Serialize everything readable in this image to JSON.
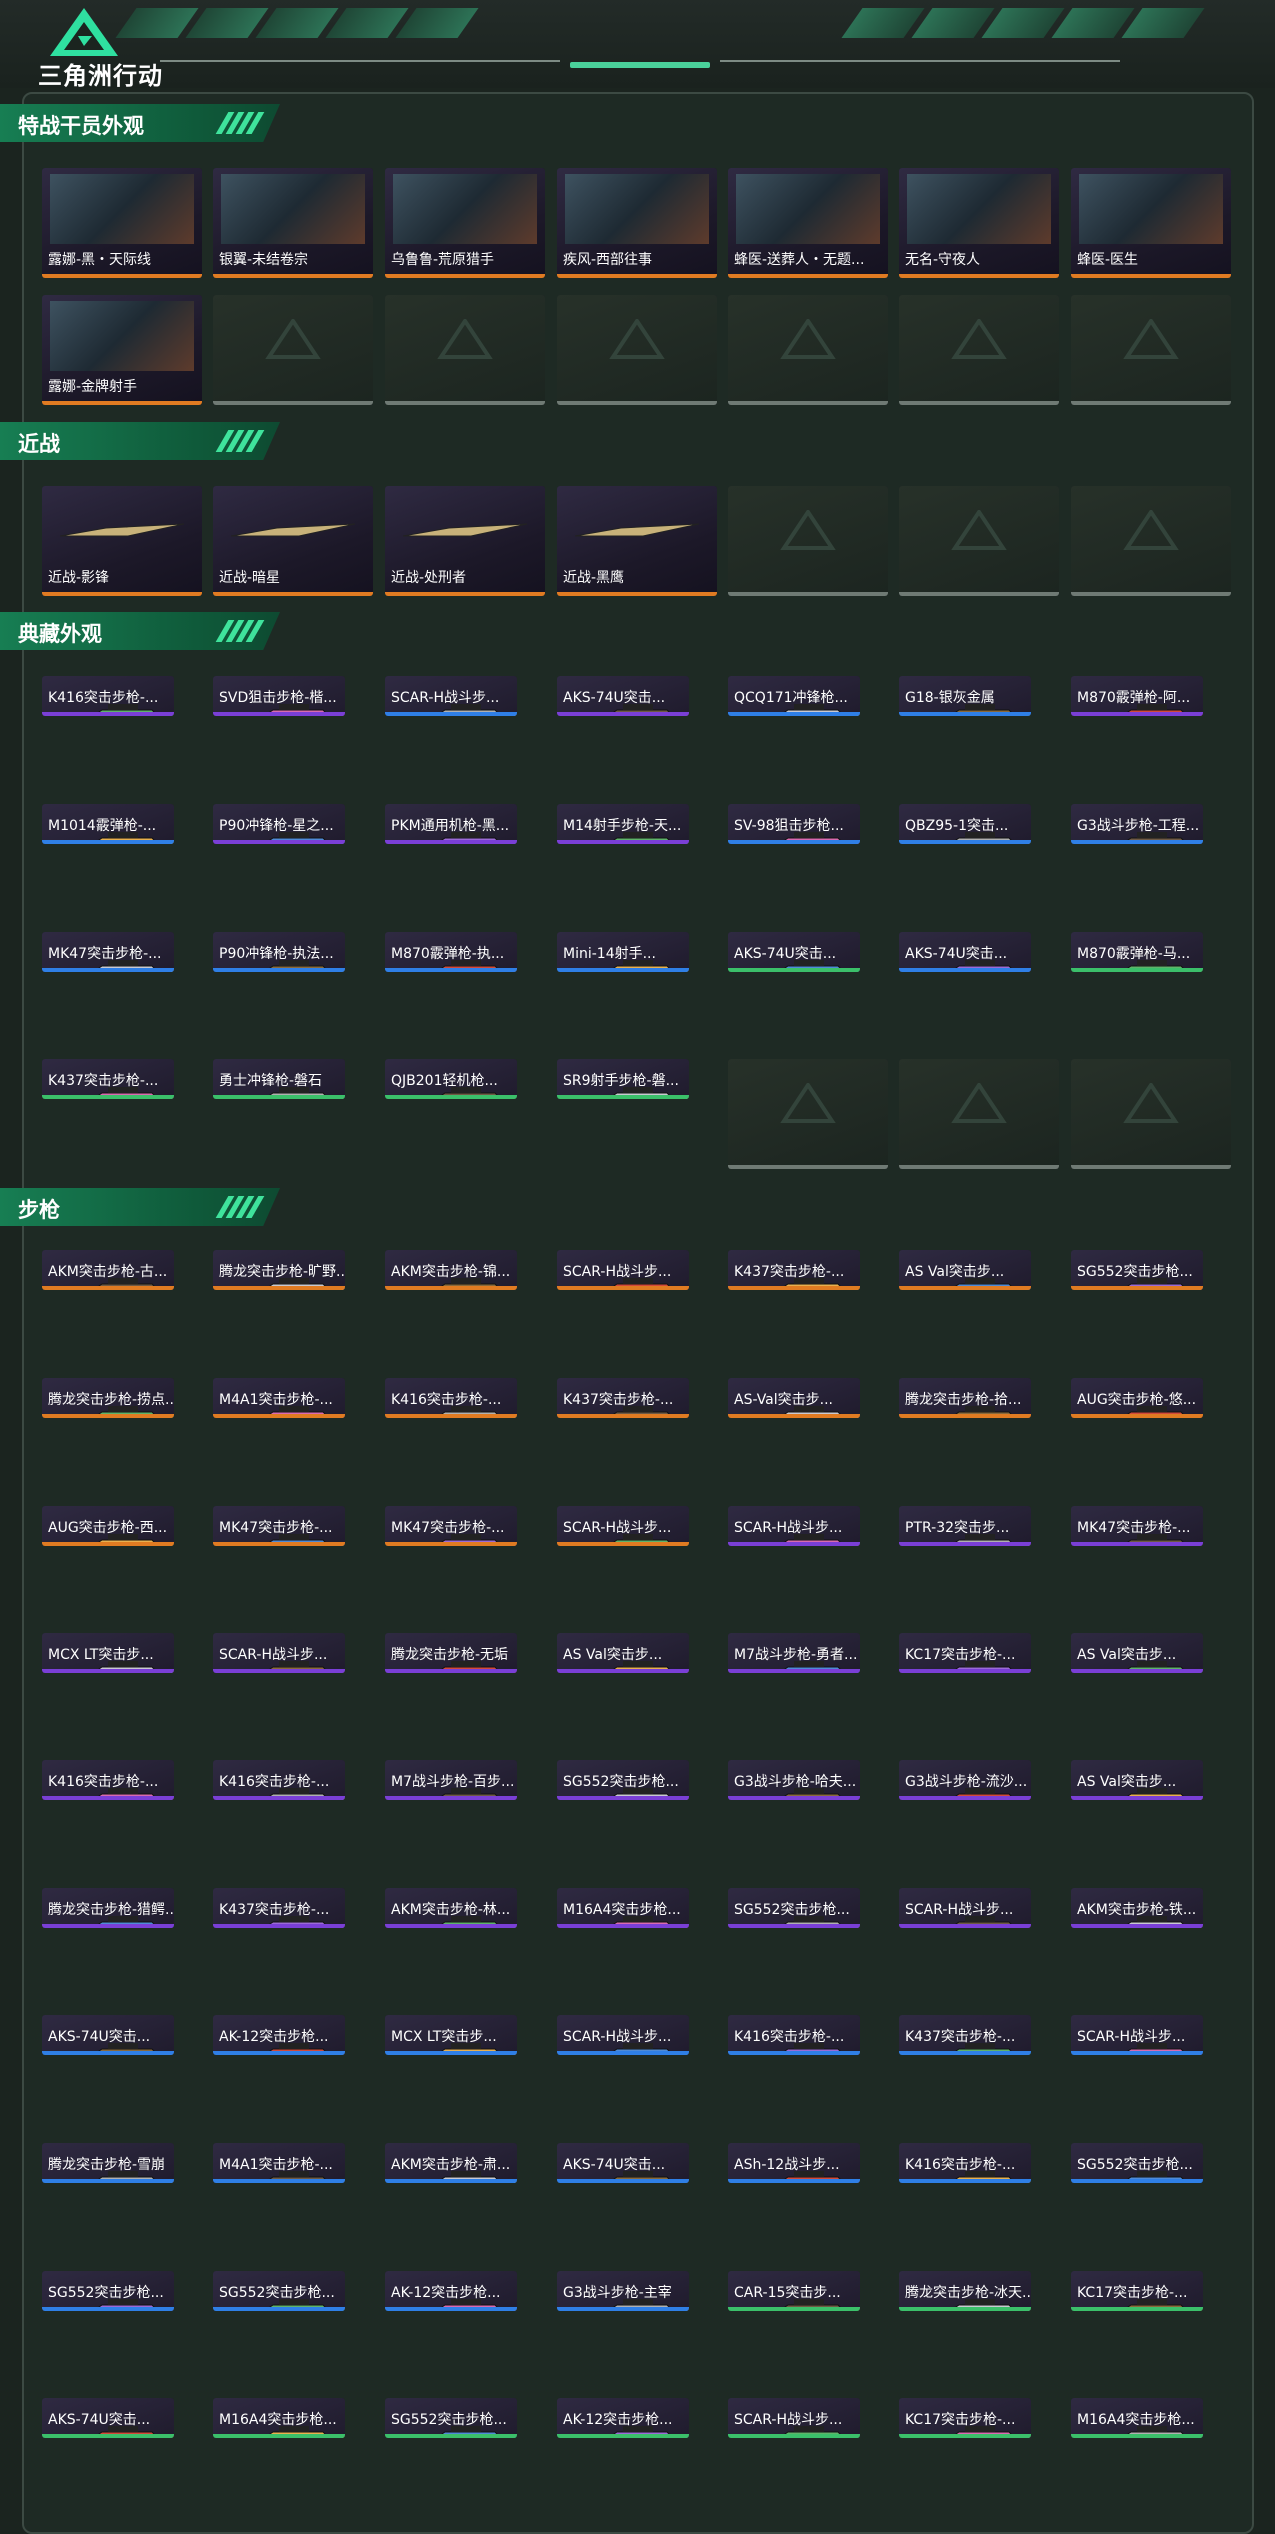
{
  "header": {
    "logo_text": "三角洲行动",
    "logo_icon": "delta-triangle-logo"
  },
  "colors": {
    "gold": "#e07b22",
    "purple": "#7a3fd6",
    "blue": "#2f7fe6",
    "green": "#3bbf6a",
    "empty": "#6f7a74",
    "accent": "#3fe39c"
  },
  "sections": [
    {
      "title": "特战干员外观",
      "items": [
        {
          "label": "露娜-黑・天际线",
          "rarity": "gold"
        },
        {
          "label": "银翼-未结卷宗",
          "rarity": "gold"
        },
        {
          "label": "乌鲁鲁-荒原猎手",
          "rarity": "gold"
        },
        {
          "label": "疾风-西部往事",
          "rarity": "gold"
        },
        {
          "label": "蜂医-送葬人・无题...",
          "rarity": "gold"
        },
        {
          "label": "无名-守夜人",
          "rarity": "gold"
        },
        {
          "label": "蜂医-医生",
          "rarity": "gold"
        },
        {
          "label": "露娜-金牌射手",
          "rarity": "gold"
        }
      ]
    },
    {
      "title": "近战",
      "items": [
        {
          "label": "近战-影锋",
          "rarity": "gold"
        },
        {
          "label": "近战-暗星",
          "rarity": "gold"
        },
        {
          "label": "近战-处刑者",
          "rarity": "gold"
        },
        {
          "label": "近战-黑鹰",
          "rarity": "gold"
        }
      ]
    },
    {
      "title": "典藏外观",
      "items": [
        {
          "label": "K416突击步枪-...",
          "rarity": "purple"
        },
        {
          "label": "SVD狙击步枪-楷...",
          "rarity": "purple"
        },
        {
          "label": "SCAR-H战斗步...",
          "rarity": "blue"
        },
        {
          "label": "AKS-74U突击...",
          "rarity": "purple"
        },
        {
          "label": "QCQ171冲锋枪...",
          "rarity": "blue"
        },
        {
          "label": "G18-银灰金属",
          "rarity": "blue"
        },
        {
          "label": "M870霰弹枪-阿...",
          "rarity": "purple"
        },
        {
          "label": "M1014霰弹枪-...",
          "rarity": "blue"
        },
        {
          "label": "P90冲锋枪-星之...",
          "rarity": "purple"
        },
        {
          "label": "PKM通用机枪-黑...",
          "rarity": "purple"
        },
        {
          "label": "M14射手步枪-天...",
          "rarity": "purple"
        },
        {
          "label": "SV-98狙击步枪...",
          "rarity": "blue"
        },
        {
          "label": "QBZ95-1突击...",
          "rarity": "blue"
        },
        {
          "label": "G3战斗步枪-工程...",
          "rarity": "blue"
        },
        {
          "label": "MK47突击步枪-...",
          "rarity": "blue"
        },
        {
          "label": "P90冲锋枪-执法...",
          "rarity": "blue"
        },
        {
          "label": "M870霰弹枪-执...",
          "rarity": "blue"
        },
        {
          "label": "Mini-14射手...",
          "rarity": "blue"
        },
        {
          "label": "AKS-74U突击...",
          "rarity": "green"
        },
        {
          "label": "AKS-74U突击...",
          "rarity": "blue"
        },
        {
          "label": "M870霰弹枪-马...",
          "rarity": "green"
        },
        {
          "label": "K437突击步枪-...",
          "rarity": "green"
        },
        {
          "label": "勇士冲锋枪-磐石",
          "rarity": "green"
        },
        {
          "label": "QJB201轻机枪...",
          "rarity": "green"
        },
        {
          "label": "SR9射手步枪-磐...",
          "rarity": "green"
        }
      ]
    },
    {
      "title": "步枪",
      "items": [
        {
          "label": "AKM突击步枪-古...",
          "rarity": "gold"
        },
        {
          "label": "腾龙突击步枪-旷野...",
          "rarity": "gold"
        },
        {
          "label": "AKM突击步枪-锦...",
          "rarity": "gold"
        },
        {
          "label": "SCAR-H战斗步...",
          "rarity": "gold"
        },
        {
          "label": "K437突击步枪-...",
          "rarity": "gold"
        },
        {
          "label": "AS Val突击步...",
          "rarity": "gold"
        },
        {
          "label": "SG552突击步枪...",
          "rarity": "gold"
        },
        {
          "label": "腾龙突击步枪-捞点...",
          "rarity": "gold"
        },
        {
          "label": "M4A1突击步枪-...",
          "rarity": "gold"
        },
        {
          "label": "K416突击步枪-...",
          "rarity": "gold"
        },
        {
          "label": "K437突击步枪-...",
          "rarity": "gold"
        },
        {
          "label": "AS-Val突击步...",
          "rarity": "gold"
        },
        {
          "label": "腾龙突击步枪-拾...",
          "rarity": "gold"
        },
        {
          "label": "AUG突击步枪-悠...",
          "rarity": "gold"
        },
        {
          "label": "AUG突击步枪-西...",
          "rarity": "gold"
        },
        {
          "label": "MK47突击步枪-...",
          "rarity": "gold"
        },
        {
          "label": "MK47突击步枪-...",
          "rarity": "gold"
        },
        {
          "label": "SCAR-H战斗步...",
          "rarity": "gold"
        },
        {
          "label": "SCAR-H战斗步...",
          "rarity": "purple"
        },
        {
          "label": "PTR-32突击步...",
          "rarity": "purple"
        },
        {
          "label": "MK47突击步枪-...",
          "rarity": "purple"
        },
        {
          "label": "MCX LT突击步...",
          "rarity": "purple"
        },
        {
          "label": "SCAR-H战斗步...",
          "rarity": "purple"
        },
        {
          "label": "腾龙突击步枪-无垢",
          "rarity": "purple"
        },
        {
          "label": "AS Val突击步...",
          "rarity": "purple"
        },
        {
          "label": "M7战斗步枪-勇者...",
          "rarity": "purple"
        },
        {
          "label": "KC17突击步枪-...",
          "rarity": "purple"
        },
        {
          "label": "AS Val突击步...",
          "rarity": "purple"
        },
        {
          "label": "K416突击步枪-...",
          "rarity": "purple"
        },
        {
          "label": "K416突击步枪-...",
          "rarity": "purple"
        },
        {
          "label": "M7战斗步枪-百步...",
          "rarity": "purple"
        },
        {
          "label": "SG552突击步枪...",
          "rarity": "purple"
        },
        {
          "label": "G3战斗步枪-哈夫...",
          "rarity": "purple"
        },
        {
          "label": "G3战斗步枪-流沙...",
          "rarity": "purple"
        },
        {
          "label": "AS Val突击步...",
          "rarity": "purple"
        },
        {
          "label": "腾龙突击步枪-猎鳄...",
          "rarity": "purple"
        },
        {
          "label": "K437突击步枪-...",
          "rarity": "purple"
        },
        {
          "label": "AKM突击步枪-林...",
          "rarity": "purple"
        },
        {
          "label": "M16A4突击步枪...",
          "rarity": "purple"
        },
        {
          "label": "SG552突击步枪...",
          "rarity": "purple"
        },
        {
          "label": "SCAR-H战斗步...",
          "rarity": "purple"
        },
        {
          "label": "AKM突击步枪-铁...",
          "rarity": "purple"
        },
        {
          "label": "AKS-74U突击...",
          "rarity": "blue"
        },
        {
          "label": "AK-12突击步枪...",
          "rarity": "blue"
        },
        {
          "label": "MCX LT突击步...",
          "rarity": "blue"
        },
        {
          "label": "SCAR-H战斗步...",
          "rarity": "blue"
        },
        {
          "label": "K416突击步枪-...",
          "rarity": "blue"
        },
        {
          "label": "K437突击步枪-...",
          "rarity": "blue"
        },
        {
          "label": "SCAR-H战斗步...",
          "rarity": "blue"
        },
        {
          "label": "腾龙突击步枪-雪崩",
          "rarity": "blue"
        },
        {
          "label": "M4A1突击步枪-...",
          "rarity": "blue"
        },
        {
          "label": "AKM突击步枪-肃...",
          "rarity": "blue"
        },
        {
          "label": "AKS-74U突击...",
          "rarity": "blue"
        },
        {
          "label": "ASh-12战斗步...",
          "rarity": "blue"
        },
        {
          "label": "K416突击步枪-...",
          "rarity": "blue"
        },
        {
          "label": "SG552突击步枪...",
          "rarity": "blue"
        },
        {
          "label": "SG552突击步枪...",
          "rarity": "blue"
        },
        {
          "label": "SG552突击步枪...",
          "rarity": "blue"
        },
        {
          "label": "AK-12突击步枪...",
          "rarity": "blue"
        },
        {
          "label": "G3战斗步枪-主宰",
          "rarity": "blue"
        },
        {
          "label": "CAR-15突击步...",
          "rarity": "green"
        },
        {
          "label": "腾龙突击步枪-冰天...",
          "rarity": "green"
        },
        {
          "label": "KC17突击步枪-...",
          "rarity": "green"
        },
        {
          "label": "AKS-74U突击...",
          "rarity": "green"
        },
        {
          "label": "M16A4突击步枪...",
          "rarity": "green"
        },
        {
          "label": "SG552突击步枪...",
          "rarity": "green"
        },
        {
          "label": "AK-12突击步枪...",
          "rarity": "green"
        },
        {
          "label": "SCAR-H战斗步...",
          "rarity": "green"
        },
        {
          "label": "KC17突击步枪-...",
          "rarity": "green"
        },
        {
          "label": "M16A4突击步枪...",
          "rarity": "green"
        }
      ]
    }
  ]
}
